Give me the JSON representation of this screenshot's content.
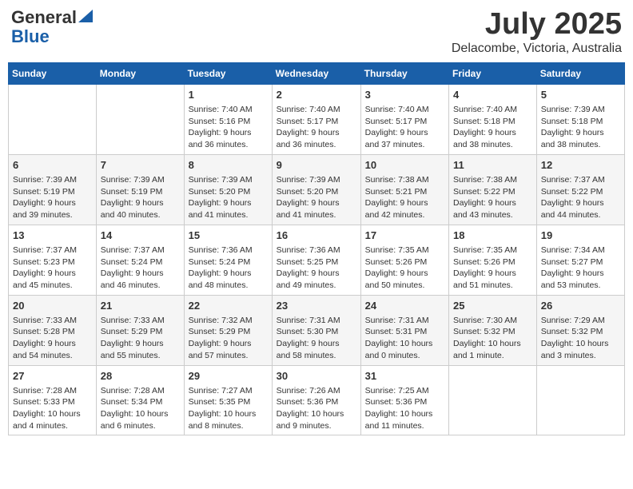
{
  "logo": {
    "general": "General",
    "blue": "Blue"
  },
  "title": "July 2025",
  "location": "Delacombe, Victoria, Australia",
  "days_header": [
    "Sunday",
    "Monday",
    "Tuesday",
    "Wednesday",
    "Thursday",
    "Friday",
    "Saturday"
  ],
  "weeks": [
    [
      {
        "day": "",
        "info": ""
      },
      {
        "day": "",
        "info": ""
      },
      {
        "day": "1",
        "info": "Sunrise: 7:40 AM\nSunset: 5:16 PM\nDaylight: 9 hours\nand 36 minutes."
      },
      {
        "day": "2",
        "info": "Sunrise: 7:40 AM\nSunset: 5:17 PM\nDaylight: 9 hours\nand 36 minutes."
      },
      {
        "day": "3",
        "info": "Sunrise: 7:40 AM\nSunset: 5:17 PM\nDaylight: 9 hours\nand 37 minutes."
      },
      {
        "day": "4",
        "info": "Sunrise: 7:40 AM\nSunset: 5:18 PM\nDaylight: 9 hours\nand 38 minutes."
      },
      {
        "day": "5",
        "info": "Sunrise: 7:39 AM\nSunset: 5:18 PM\nDaylight: 9 hours\nand 38 minutes."
      }
    ],
    [
      {
        "day": "6",
        "info": "Sunrise: 7:39 AM\nSunset: 5:19 PM\nDaylight: 9 hours\nand 39 minutes."
      },
      {
        "day": "7",
        "info": "Sunrise: 7:39 AM\nSunset: 5:19 PM\nDaylight: 9 hours\nand 40 minutes."
      },
      {
        "day": "8",
        "info": "Sunrise: 7:39 AM\nSunset: 5:20 PM\nDaylight: 9 hours\nand 41 minutes."
      },
      {
        "day": "9",
        "info": "Sunrise: 7:39 AM\nSunset: 5:20 PM\nDaylight: 9 hours\nand 41 minutes."
      },
      {
        "day": "10",
        "info": "Sunrise: 7:38 AM\nSunset: 5:21 PM\nDaylight: 9 hours\nand 42 minutes."
      },
      {
        "day": "11",
        "info": "Sunrise: 7:38 AM\nSunset: 5:22 PM\nDaylight: 9 hours\nand 43 minutes."
      },
      {
        "day": "12",
        "info": "Sunrise: 7:37 AM\nSunset: 5:22 PM\nDaylight: 9 hours\nand 44 minutes."
      }
    ],
    [
      {
        "day": "13",
        "info": "Sunrise: 7:37 AM\nSunset: 5:23 PM\nDaylight: 9 hours\nand 45 minutes."
      },
      {
        "day": "14",
        "info": "Sunrise: 7:37 AM\nSunset: 5:24 PM\nDaylight: 9 hours\nand 46 minutes."
      },
      {
        "day": "15",
        "info": "Sunrise: 7:36 AM\nSunset: 5:24 PM\nDaylight: 9 hours\nand 48 minutes."
      },
      {
        "day": "16",
        "info": "Sunrise: 7:36 AM\nSunset: 5:25 PM\nDaylight: 9 hours\nand 49 minutes."
      },
      {
        "day": "17",
        "info": "Sunrise: 7:35 AM\nSunset: 5:26 PM\nDaylight: 9 hours\nand 50 minutes."
      },
      {
        "day": "18",
        "info": "Sunrise: 7:35 AM\nSunset: 5:26 PM\nDaylight: 9 hours\nand 51 minutes."
      },
      {
        "day": "19",
        "info": "Sunrise: 7:34 AM\nSunset: 5:27 PM\nDaylight: 9 hours\nand 53 minutes."
      }
    ],
    [
      {
        "day": "20",
        "info": "Sunrise: 7:33 AM\nSunset: 5:28 PM\nDaylight: 9 hours\nand 54 minutes."
      },
      {
        "day": "21",
        "info": "Sunrise: 7:33 AM\nSunset: 5:29 PM\nDaylight: 9 hours\nand 55 minutes."
      },
      {
        "day": "22",
        "info": "Sunrise: 7:32 AM\nSunset: 5:29 PM\nDaylight: 9 hours\nand 57 minutes."
      },
      {
        "day": "23",
        "info": "Sunrise: 7:31 AM\nSunset: 5:30 PM\nDaylight: 9 hours\nand 58 minutes."
      },
      {
        "day": "24",
        "info": "Sunrise: 7:31 AM\nSunset: 5:31 PM\nDaylight: 10 hours\nand 0 minutes."
      },
      {
        "day": "25",
        "info": "Sunrise: 7:30 AM\nSunset: 5:32 PM\nDaylight: 10 hours\nand 1 minute."
      },
      {
        "day": "26",
        "info": "Sunrise: 7:29 AM\nSunset: 5:32 PM\nDaylight: 10 hours\nand 3 minutes."
      }
    ],
    [
      {
        "day": "27",
        "info": "Sunrise: 7:28 AM\nSunset: 5:33 PM\nDaylight: 10 hours\nand 4 minutes."
      },
      {
        "day": "28",
        "info": "Sunrise: 7:28 AM\nSunset: 5:34 PM\nDaylight: 10 hours\nand 6 minutes."
      },
      {
        "day": "29",
        "info": "Sunrise: 7:27 AM\nSunset: 5:35 PM\nDaylight: 10 hours\nand 8 minutes."
      },
      {
        "day": "30",
        "info": "Sunrise: 7:26 AM\nSunset: 5:36 PM\nDaylight: 10 hours\nand 9 minutes."
      },
      {
        "day": "31",
        "info": "Sunrise: 7:25 AM\nSunset: 5:36 PM\nDaylight: 10 hours\nand 11 minutes."
      },
      {
        "day": "",
        "info": ""
      },
      {
        "day": "",
        "info": ""
      }
    ]
  ]
}
